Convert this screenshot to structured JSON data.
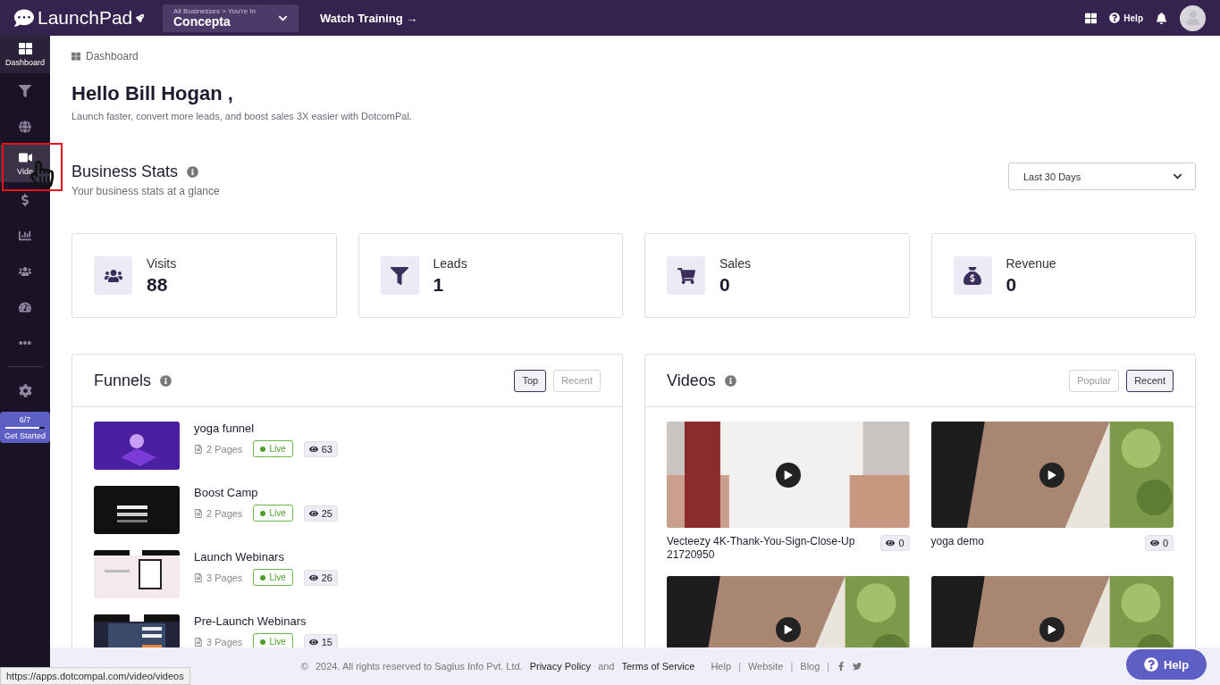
{
  "topbar": {
    "brand": "LaunchPad",
    "business": {
      "crumb": "All Businesses > You're In",
      "name": "Concepta"
    },
    "training_link": "Watch Training →",
    "help": "Help"
  },
  "sidebar": {
    "items": [
      {
        "label": "Dashboard",
        "selected": true,
        "highlighted": false
      },
      {
        "selected": false,
        "highlighted": false
      },
      {
        "selected": false,
        "highlighted": false
      },
      {
        "label": "Vide",
        "selected": false,
        "highlighted": true
      },
      {
        "selected": false,
        "highlighted": false
      },
      {
        "selected": false,
        "highlighted": false
      },
      {
        "selected": false,
        "highlighted": false
      },
      {
        "selected": false,
        "highlighted": false
      },
      {
        "selected": false,
        "highlighted": false
      }
    ],
    "progress": {
      "count": "6/7",
      "level": 0.86,
      "label": "Get Started"
    }
  },
  "breadcrumb": "Dashboard",
  "greeting": {
    "title": "Hello Bill Hogan ,",
    "subtitle": "Launch faster, convert more leads, and boost sales 3X easier with DotcomPal."
  },
  "business_stats": {
    "title": "Business Stats",
    "subtitle": "Your business stats at a glance",
    "range": "Last 30 Days",
    "cards": [
      {
        "label": "Visits",
        "value": "88"
      },
      {
        "label": "Leads",
        "value": "1"
      },
      {
        "label": "Sales",
        "value": "0"
      },
      {
        "label": "Revenue",
        "value": "0"
      }
    ]
  },
  "funnels": {
    "title": "Funnels",
    "filters": [
      {
        "label": "Top",
        "selected": true
      },
      {
        "label": "Recent",
        "selected": false
      }
    ],
    "rows": [
      {
        "name": "yoga funnel",
        "pages": "2 Pages",
        "status": "Live",
        "views": "63"
      },
      {
        "name": "Boost Camp",
        "pages": "2 Pages",
        "status": "Live",
        "views": "25"
      },
      {
        "name": "Launch Webinars",
        "pages": "3 Pages",
        "status": "Live",
        "views": "26"
      },
      {
        "name": "Pre-Launch Webinars",
        "pages": "3 Pages",
        "status": "Live",
        "views": "15"
      }
    ]
  },
  "videos": {
    "title": "Videos",
    "filters": [
      {
        "label": "Popular",
        "selected": false
      },
      {
        "label": "Recent",
        "selected": true
      }
    ],
    "items": [
      {
        "kind": "picture",
        "title": "Vecteezy 4K-Thank-You-Sign-Close-Up 21720950",
        "views": "0"
      },
      {
        "kind": "picture",
        "title": "yoga demo",
        "views": "0"
      },
      {
        "kind": "picture"
      },
      {
        "kind": "picture"
      }
    ]
  },
  "footer": {
    "copyright_mark": "©",
    "separator": "|",
    "copyright": "2024. All rights reserved to Saglus Info Pvt. Ltd.",
    "privacy": "Privacy Policy",
    "and": "and",
    "terms": "Terms of Service",
    "links": [
      "Help",
      "Website",
      "Blog"
    ]
  },
  "help_button": "Help",
  "status_url": "https://apps.dotcompal.com/video/videos"
}
